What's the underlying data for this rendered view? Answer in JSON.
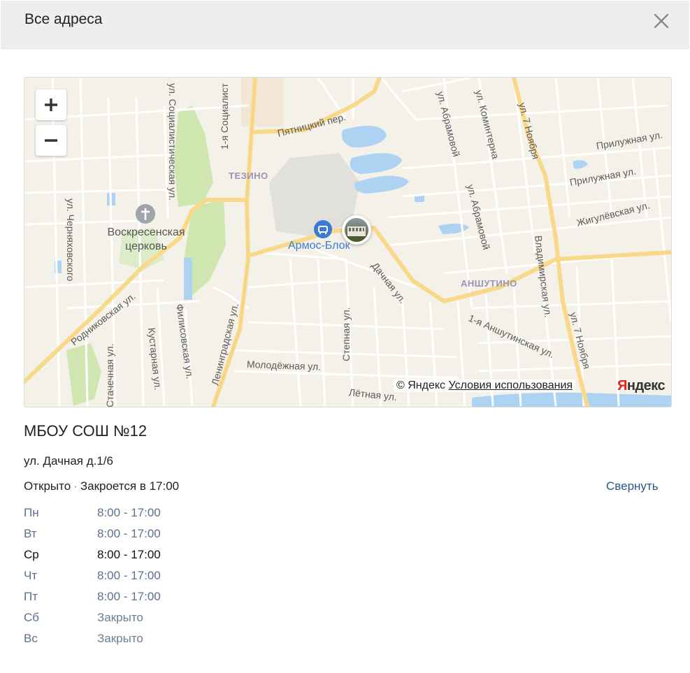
{
  "dialog": {
    "title": "Все адреса"
  },
  "map": {
    "zoom_in": "+",
    "zoom_out": "−",
    "districts": [
      "ТЕЗИНО",
      "АНШУТИНО"
    ],
    "streets": [
      "ул. Социалистическая ул.",
      "1-я Социалист",
      "Пятницкий пер.",
      "ул. Абрамовой",
      "ул. Коминтерна",
      "ул. 7 Ноября",
      "Прилужная ул.",
      "Прилужная ул.",
      "Жигулёвская ул.",
      "ул. Абрамовой",
      "ул. Черняховского",
      "Родниковская ул.",
      "Дачная ул.",
      "Владимирская ул.",
      "ул. 7 Ноября",
      "1-я Аншутинская ул.",
      "Ленинградская ул.",
      "Степная ул.",
      "Стачечная ул.",
      "Кустарная ул.",
      "Филисовская ул.",
      "Молодёжная ул.",
      "Лётная ул."
    ],
    "church": "Воскресенская церковь",
    "poi": "Армос-Блок",
    "copyright_prefix": "© Яндекс",
    "terms_link": "Условия использования",
    "logo_first": "Я",
    "logo_rest": "ндекс"
  },
  "org": {
    "name": "МБОУ СОШ №12",
    "address": "ул. Дачная д.1/6",
    "status": "Открыто",
    "dot": "·",
    "closes": "Закроется в 17:00",
    "collapse": "Свернуть"
  },
  "hours": [
    {
      "day": "Пн",
      "time": "8:00 - 17:00"
    },
    {
      "day": "Вт",
      "time": "8:00 - 17:00"
    },
    {
      "day": "Ср",
      "time": "8:00 - 17:00"
    },
    {
      "day": "Чт",
      "time": "8:00 - 17:00"
    },
    {
      "day": "Пт",
      "time": "8:00 - 17:00"
    },
    {
      "day": "Сб",
      "time": "Закрыто"
    },
    {
      "day": "Вс",
      "time": "Закрыто"
    }
  ],
  "colors": {
    "link": "#2a5885",
    "poi": "#3a7bd5",
    "header_bg": "#edeef0",
    "map_bg": "#f4f1e9",
    "main_road": "#f8d98a",
    "park": "#cfe6b0",
    "water": "#aed3f2"
  },
  "icons": [
    "close-icon",
    "plus-icon",
    "minus-icon",
    "church-icon",
    "poi-icon",
    "location-photo-marker"
  ]
}
